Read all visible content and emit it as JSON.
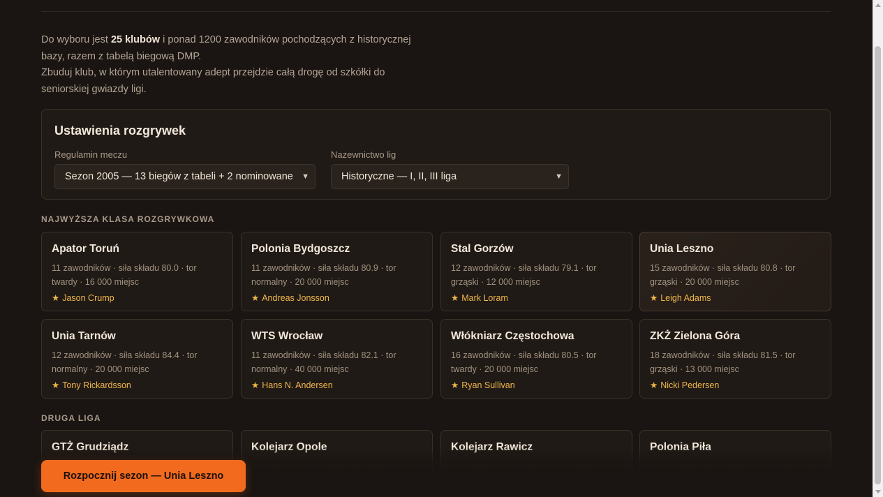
{
  "intro": {
    "line1_pre": "Do wyboru jest ",
    "line1_bold": "25 klubów",
    "line1_post": " i ponad 1200 zawodników pochodzących z historycznej bazy, razem z tabelą biegową DMP.",
    "line2": "Zbuduj klub, w którym utalentowany adept przejdzie całą drogę od szkółki do seniorskiej gwiazdy ligi."
  },
  "settings": {
    "title": "Ustawienia rozgrywek",
    "rules_label": "Regulamin meczu",
    "rules_value": "Sezon 2005 — 13 biegów z tabeli + 2 nominowane",
    "naming_label": "Nazewnictwo lig",
    "naming_value": "Historyczne — I, II, III liga"
  },
  "sections": {
    "top_league_title": "NAJWYŻSZA KLASA ROZGRYWKOWA",
    "second_league_title": "DRUGA LIGA"
  },
  "top_clubs": [
    {
      "name": "Apator Toruń",
      "meta": "11 zawodników · siła składu 80.0 · tor twardy · 16 000 miejsc",
      "star": "Jason Crump"
    },
    {
      "name": "Polonia Bydgoszcz",
      "meta": "11 zawodników · siła składu 80.9 · tor normalny · 20 000 miejsc",
      "star": "Andreas Jonsson"
    },
    {
      "name": "Stal Gorzów",
      "meta": "12 zawodników · siła składu 79.1 · tor grząski · 12 000 miejsc",
      "star": "Mark Loram"
    },
    {
      "name": "Unia Leszno",
      "meta": "15 zawodników · siła składu 80.8 · tor grząski · 20 000 miejsc",
      "star": "Leigh Adams"
    },
    {
      "name": "Unia Tarnów",
      "meta": "12 zawodników · siła składu 84.4 · tor normalny · 20 000 miejsc",
      "star": "Tony Rickardsson"
    },
    {
      "name": "WTS Wrocław",
      "meta": "11 zawodników · siła składu 82.1 · tor normalny · 40 000 miejsc",
      "star": "Hans N. Andersen"
    },
    {
      "name": "Włókniarz Częstochowa",
      "meta": "16 zawodników · siła składu 80.5 · tor twardy · 20 000 miejsc",
      "star": "Ryan Sullivan"
    },
    {
      "name": "ZKŻ Zielona Góra",
      "meta": "18 zawodników · siła składu 81.5 · tor grząski · 13 000 miejsc",
      "star": "Nicki Pedersen"
    }
  ],
  "second_clubs": [
    {
      "name": "GTŻ Grudziądz"
    },
    {
      "name": "Kolejarz Opole"
    },
    {
      "name": "Kolejarz Rawicz"
    },
    {
      "name": "Polonia Piła"
    }
  ],
  "star_glyph": "★",
  "cta_label": "Rozpocznij sezon — Unia Leszno",
  "colors": {
    "accent": "#f26a1e",
    "star": "#f0b84a",
    "background": "#1a1512"
  }
}
